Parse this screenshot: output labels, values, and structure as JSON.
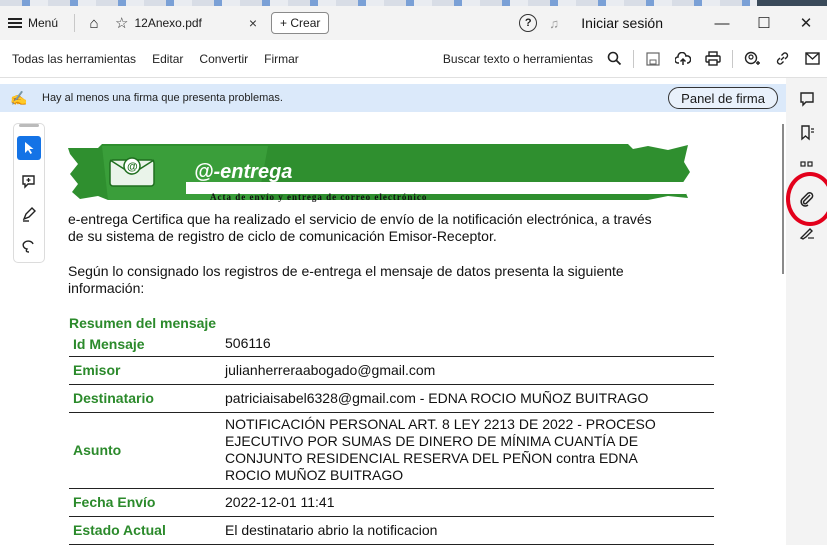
{
  "titlebar": {
    "menu_label": "Menú",
    "tab_title": "12Anexo.pdf",
    "tab_close": "×",
    "create_label": "+ Crear",
    "signin_label": "Iniciar sesión",
    "minimize": "—",
    "maximize": "☐",
    "close": "✕"
  },
  "toolbar": {
    "items": [
      "Todas las herramientas",
      "Editar",
      "Convertir",
      "Firmar"
    ],
    "search_label": "Buscar texto o herramientas"
  },
  "notice": {
    "text": "Hay al menos una firma que presenta problemas.",
    "panel_button": "Panel de firma"
  },
  "document": {
    "banner_title": "@-entrega",
    "banner_subtitle": "Acta de envío y entrega de correo electrónico",
    "paragraph1_line1": "e-entrega Certifica que ha realizado el servicio de envío de la notificación electrónica, a través",
    "paragraph1_line2": "de su sistema de registro de ciclo de comunicación Emisor-Receptor.",
    "paragraph2_line1": "Según lo consignado los registros de e-entrega el mensaje de datos presenta la siguiente",
    "paragraph2_line2": "información:",
    "section_title": "Resumen del mensaje",
    "rows": [
      {
        "key": "Id Mensaje",
        "value": "506116"
      },
      {
        "key": "Emisor",
        "value": "julianherreraabogado@gmail.com"
      },
      {
        "key": "Destinatario",
        "value": "patriciaisabel6328@gmail.com - EDNA ROCIO MUÑOZ BUITRAGO"
      },
      {
        "key": "Asunto",
        "value_lines": [
          "NOTIFICACIÓN PERSONAL ART. 8 LEY 2213 DE 2022 - PROCESO",
          "EJECUTIVO POR SUMAS DE DINERO DE MÍNIMA CUANTÍA DE",
          "CONJUNTO RESIDENCIAL RESERVA DEL PEÑON contra EDNA",
          "ROCIO MUÑOZ BUITRAGO"
        ]
      },
      {
        "key": "Fecha Envío",
        "value": "2022-12-01 11:41"
      },
      {
        "key": "Estado Actual",
        "value": "El destinatario abrio la notificacion"
      }
    ]
  },
  "colors": {
    "accent_green": "#2b8a2b",
    "notice_bg": "#dbe9fa",
    "highlight_red": "#e3001b",
    "tool_active": "#1473e6"
  }
}
